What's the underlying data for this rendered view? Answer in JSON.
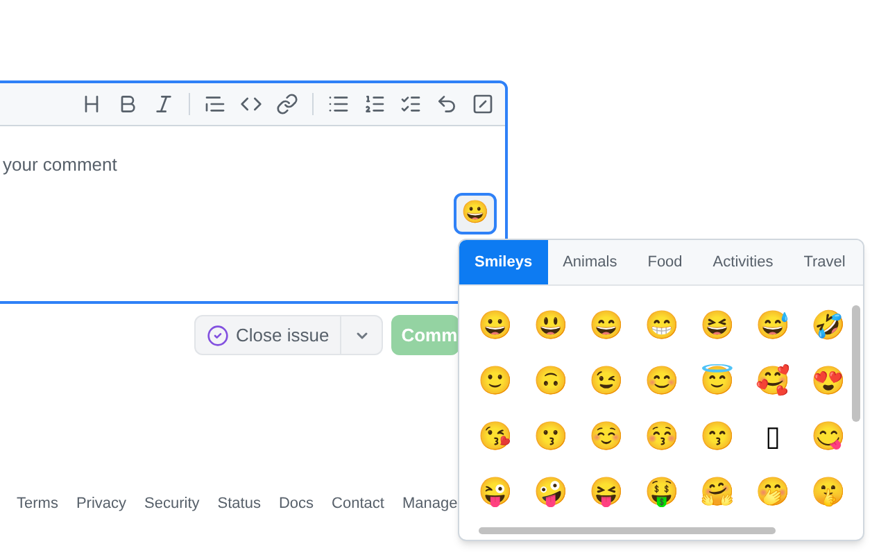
{
  "editor": {
    "placeholder": "your comment",
    "emoji_button": "😀"
  },
  "actions": [
    {
      "label": "Close issue",
      "kind": "close"
    },
    {
      "label": "Comm",
      "kind": "primary"
    }
  ],
  "footer_links": [
    "Terms",
    "Privacy",
    "Security",
    "Status",
    "Docs",
    "Contact",
    "Manage"
  ],
  "emoji_picker": {
    "tabs": [
      {
        "label": "Smileys",
        "selected": true
      },
      {
        "label": "Animals",
        "selected": false
      },
      {
        "label": "Food",
        "selected": false
      },
      {
        "label": "Activities",
        "selected": false
      },
      {
        "label": "Travel",
        "selected": false
      }
    ],
    "emojis": [
      [
        "😀",
        "😃",
        "😄",
        "😁",
        "😆",
        "😅",
        "🤣"
      ],
      [
        "🙂",
        "🙃",
        "😉",
        "😊",
        "😇",
        "🥰",
        "😍"
      ],
      [
        "😘",
        "😗",
        "☺️",
        "😚",
        "😙",
        "▯",
        "😋"
      ],
      [
        "😜",
        "🤪",
        "😝",
        "🤑",
        "🤗",
        "🤭",
        "🤫"
      ]
    ]
  }
}
